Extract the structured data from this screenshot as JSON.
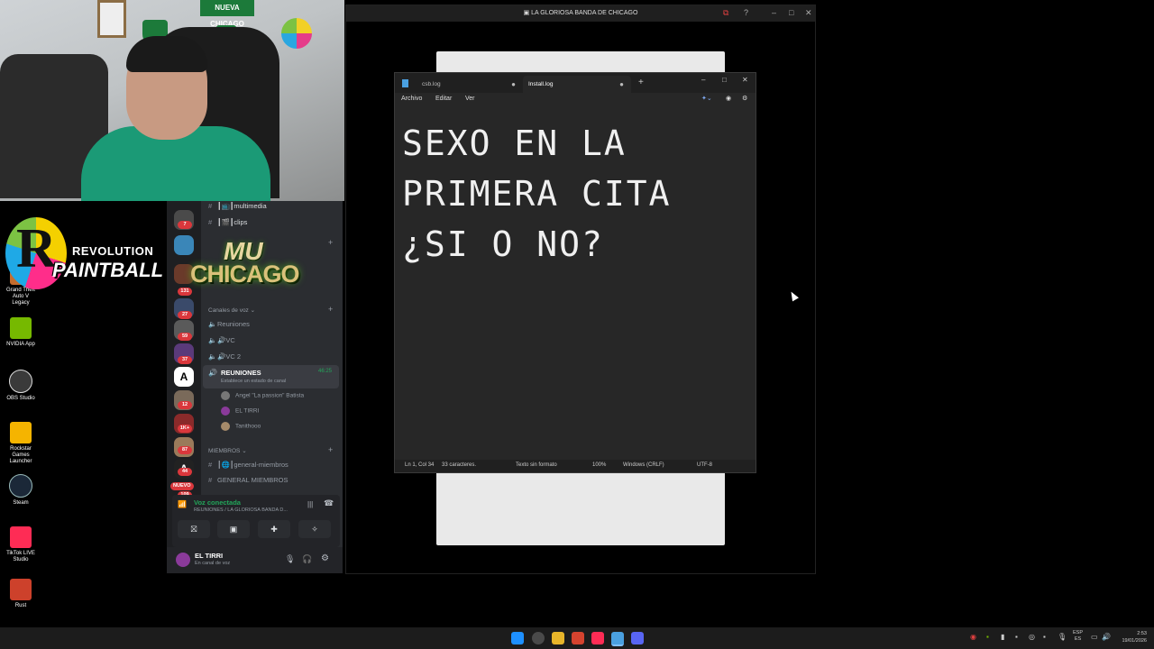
{
  "webcam": {
    "banner": "NUEVA CHICAGO"
  },
  "desktop_icons": [
    {
      "label": "Grand Theft Auto V Legacy",
      "color": "#c46d2e"
    },
    {
      "label": "NVIDIA App",
      "color": "#76b900"
    },
    {
      "label": "OBS Studio",
      "color": "#3a3a3a"
    },
    {
      "label": "Rockstar Games Launcher",
      "color": "#f5b400"
    },
    {
      "label": "Steam",
      "color": "#1b2838"
    },
    {
      "label": "TikTok LIVE Studio",
      "color": "#fe2c55"
    },
    {
      "label": "Rust",
      "color": "#cd412b"
    }
  ],
  "overlay_logo": {
    "letter": "R",
    "line1": "REVOLUTION",
    "line2": "PAINTBALL"
  },
  "discord": {
    "channels_top": [
      {
        "name": "┃📺┃multimedia"
      },
      {
        "name": "┃🎬┃clips"
      }
    ],
    "server_banner": {
      "line1": "MU",
      "line2": "CHICAGO"
    },
    "voice_category": "Canales de voz",
    "voice_channels": [
      "Reuniones",
      "🔊VC",
      "🔊VC 2"
    ],
    "active_voice": {
      "name": "REUNIONES",
      "timer": "46:25",
      "status": "Establece un estado de canal"
    },
    "voice_users": [
      "Angel \"La passion\" Batista",
      "EL TIRRI",
      "Tanithooo"
    ],
    "members_category": "MIEMBROS",
    "member_channels": [
      "┃🌐┃general-miembros",
      "GENERAL MIEMBROS"
    ],
    "server_badges": [
      "7",
      "131",
      "27",
      "59",
      "37",
      "12",
      "1K+",
      "87",
      "44",
      "NUEVO",
      "109"
    ],
    "connection": {
      "title": "Voz conectada",
      "subtitle": "REUNIONES / LA GLORIOSA BANDA D..."
    },
    "user": {
      "name": "EL TIRRI",
      "status": "En canal de voz"
    }
  },
  "window": {
    "title": "LA GLORIOSA BANDA DE CHICAGO"
  },
  "notepad": {
    "tabs": [
      {
        "label": "csb.log"
      },
      {
        "label": "Install.log"
      }
    ],
    "menu": [
      "Archivo",
      "Editar",
      "Ver"
    ],
    "content": "SEXO EN LA\nPRIMERA CITA\n¿SI O NO?",
    "status": {
      "position": "Ln 1, Col 34",
      "chars": "33 caracteres.",
      "format": "Texto sin formato",
      "zoom": "100%",
      "eol": "Windows (CRLF)",
      "encoding": "UTF-8"
    }
  },
  "taskbar": {
    "lang": "ESP",
    "lang2": "ES",
    "time": "2:53",
    "date": "19/01/2026"
  }
}
